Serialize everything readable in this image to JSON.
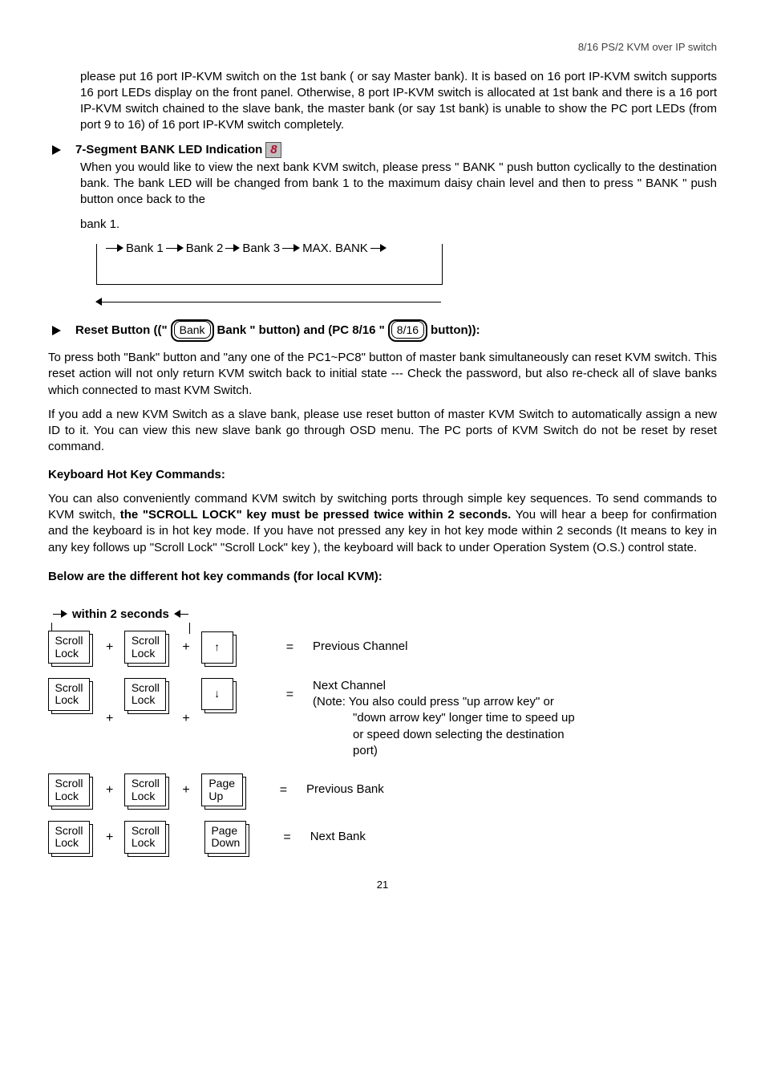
{
  "header": {
    "right": "8/16  PS/2  KVM  over  IP  switch"
  },
  "intro": "please put 16 port IP-KVM switch on the 1st bank ( or say Master bank). It is based on 16 port IP-KVM switch supports 16 port LEDs display on the front panel. Otherwise, 8 port IP-KVM switch is allocated at 1st bank and there is a 16 port IP-KVM switch chained to the slave bank, the master bank (or say 1st bank) is unable to show the PC port LEDs (from port 9 to 16) of 16 port IP-KVM switch completely.",
  "seg": {
    "title": "7-Segment BANK LED Indication",
    "icon": "8",
    "para": "When you would like to view the next bank KVM switch, please press \" BANK \" push button cyclically to the destination bank. The bank LED will be changed from bank 1 to the maximum daisy chain level and then to press \" BANK \" push button once back to the",
    "para_end": "bank 1."
  },
  "flow": {
    "b1": "Bank 1",
    "b2": "Bank 2",
    "b3": "Bank 3",
    "max": "MAX. BANK"
  },
  "reset": {
    "pre": "Reset Button ((\" ",
    "btn1": "Bank",
    "mid": "   Bank \" button) and (PC 8/16 \"",
    "btn2": "8/16",
    "post": "  button)):"
  },
  "reset_para1": "To press both \"Bank\" button and \"any one of the PC1~PC8\" button of master bank simultaneously can reset KVM switch. This reset action will not only return KVM switch back to initial state --- Check the password, but also re-check all of slave banks which connected to mast KVM Switch.",
  "reset_para2": "If you add a new KVM Switch as a slave bank, please use reset button of master KVM Switch to automatically assign a new ID to it. You can view this new slave bank go through OSD menu. The PC ports of KVM Switch do not be reset by reset command.",
  "khc": {
    "title": "Keyboard Hot Key Commands:",
    "p1a": "You can also conveniently command KVM switch by switching ports through simple key sequences. To send commands to KVM switch, ",
    "p1b": "the \"SCROLL LOCK\" key must be pressed twice within 2 seconds.",
    "p1c": " You will hear a beep for confirmation and the keyboard is in hot key mode. If you have not pressed any key in hot key mode within 2 seconds (It means to key in any key follows up \"Scroll Lock\" \"Scroll Lock\" key ), the keyboard will back to under Operation System (O.S.) control state."
  },
  "below": "Below are the different hot key commands (for local KVM):",
  "within": "within 2 seconds",
  "keys": {
    "scroll": "Scroll\nLock",
    "up": "↑",
    "down": "↓",
    "pgup": "Page\nUp",
    "pgdn": "Page\nDown",
    "plus": "+",
    "eq": "="
  },
  "desc": {
    "prev_ch": "Previous Channel",
    "next_ch": "Next Channel",
    "note1": "(Note: You also could press \"up arrow key\" or",
    "note2": "\"down arrow key\" longer time to speed up",
    "note3": "or speed down selecting the destination",
    "note4": "port)",
    "prev_bk": "Previous Bank",
    "next_bk": "Next Bank"
  },
  "page": "21"
}
